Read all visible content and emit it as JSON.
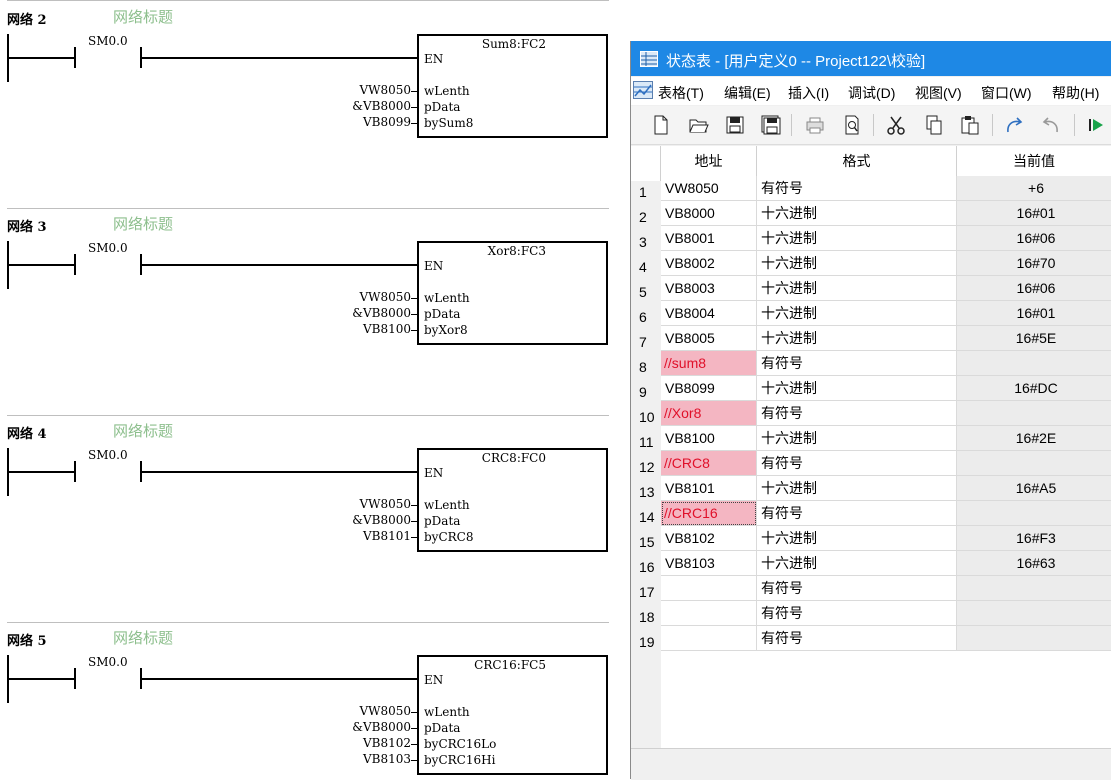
{
  "ladder": {
    "networks": [
      {
        "label": "网络 2",
        "title": "网络标题",
        "contact": "SM0.0",
        "block": "Sum8:FC2",
        "en": "EN",
        "pins": [
          {
            "op": "VW8050",
            "name": "wLenth"
          },
          {
            "op": "&VB8000",
            "name": "pData"
          },
          {
            "op": "VB8099",
            "name": "bySum8"
          }
        ]
      },
      {
        "label": "网络 3",
        "title": "网络标题",
        "contact": "SM0.0",
        "block": "Xor8:FC3",
        "en": "EN",
        "pins": [
          {
            "op": "VW8050",
            "name": "wLenth"
          },
          {
            "op": "&VB8000",
            "name": "pData"
          },
          {
            "op": "VB8100",
            "name": "byXor8"
          }
        ]
      },
      {
        "label": "网络 4",
        "title": "网络标题",
        "contact": "SM0.0",
        "block": "CRC8:FC0",
        "en": "EN",
        "pins": [
          {
            "op": "VW8050",
            "name": "wLenth"
          },
          {
            "op": "&VB8000",
            "name": "pData"
          },
          {
            "op": "VB8101",
            "name": "byCRC8"
          }
        ]
      },
      {
        "label": "网络 5",
        "title": "网络标题",
        "contact": "SM0.0",
        "block": "CRC16:FC5",
        "en": "EN",
        "pins": [
          {
            "op": "VW8050",
            "name": "wLenth"
          },
          {
            "op": "&VB8000",
            "name": "pData"
          },
          {
            "op": "VB8102",
            "name": "byCRC16Lo"
          },
          {
            "op": "VB8103",
            "name": "byCRC16Hi"
          }
        ]
      }
    ]
  },
  "window": {
    "title": "状态表 - [用户定义0 -- Project122\\校验]",
    "title_bg": "#1e88e5",
    "menu": [
      "表格(T)",
      "编辑(E)",
      "插入(I)",
      "调试(D)",
      "视图(V)",
      "窗口(W)",
      "帮助(H)"
    ],
    "toolbar_icons": [
      "new-icon",
      "open-icon",
      "save-icon",
      "save-all-icon",
      "print-icon",
      "print-preview-icon",
      "cut-icon",
      "copy-icon",
      "paste-icon",
      "undo-icon",
      "redo-icon",
      "run-icon"
    ]
  },
  "table": {
    "headers": [
      "地址",
      "格式",
      "当前值"
    ],
    "highlight_color": "#f4b6c2",
    "rows": [
      {
        "n": "1",
        "addr": "VW8050",
        "fmt": "有符号",
        "val": "+6",
        "hl": false
      },
      {
        "n": "2",
        "addr": "VB8000",
        "fmt": "十六进制",
        "val": "16#01",
        "hl": false
      },
      {
        "n": "3",
        "addr": "VB8001",
        "fmt": "十六进制",
        "val": "16#06",
        "hl": false
      },
      {
        "n": "4",
        "addr": "VB8002",
        "fmt": "十六进制",
        "val": "16#70",
        "hl": false
      },
      {
        "n": "5",
        "addr": "VB8003",
        "fmt": "十六进制",
        "val": "16#06",
        "hl": false
      },
      {
        "n": "6",
        "addr": "VB8004",
        "fmt": "十六进制",
        "val": "16#01",
        "hl": false
      },
      {
        "n": "7",
        "addr": "VB8005",
        "fmt": "十六进制",
        "val": "16#5E",
        "hl": false
      },
      {
        "n": "8",
        "addr": "//sum8",
        "fmt": "有符号",
        "val": "",
        "hl": true
      },
      {
        "n": "9",
        "addr": "VB8099",
        "fmt": "十六进制",
        "val": "16#DC",
        "hl": false
      },
      {
        "n": "10",
        "addr": "//Xor8",
        "fmt": "有符号",
        "val": "",
        "hl": true
      },
      {
        "n": "11",
        "addr": "VB8100",
        "fmt": "十六进制",
        "val": "16#2E",
        "hl": false
      },
      {
        "n": "12",
        "addr": "//CRC8",
        "fmt": "有符号",
        "val": "",
        "hl": true
      },
      {
        "n": "13",
        "addr": "VB8101",
        "fmt": "十六进制",
        "val": "16#A5",
        "hl": false
      },
      {
        "n": "14",
        "addr": "//CRC16",
        "fmt": "有符号",
        "val": "",
        "hl": true
      },
      {
        "n": "15",
        "addr": "VB8102",
        "fmt": "十六进制",
        "val": "16#F3",
        "hl": false
      },
      {
        "n": "16",
        "addr": "VB8103",
        "fmt": "十六进制",
        "val": "16#63",
        "hl": false
      },
      {
        "n": "17",
        "addr": "",
        "fmt": "有符号",
        "val": "",
        "hl": false
      },
      {
        "n": "18",
        "addr": "",
        "fmt": "有符号",
        "val": "",
        "hl": false
      },
      {
        "n": "19",
        "addr": "",
        "fmt": "有符号",
        "val": "",
        "hl": false
      }
    ]
  }
}
